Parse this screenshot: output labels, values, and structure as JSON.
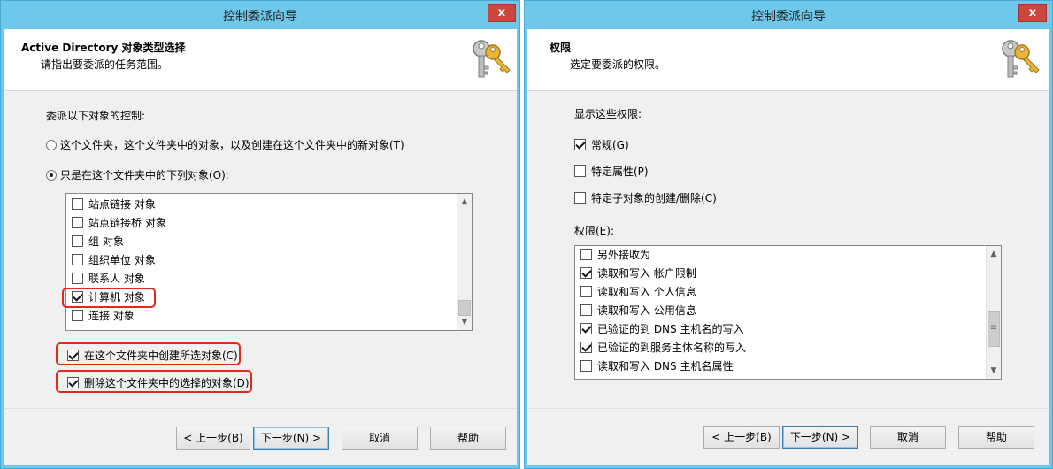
{
  "left": {
    "title": "控制委派向导",
    "close": "x",
    "header": {
      "title": "Active Directory 对象类型选择",
      "subtitle": "请指出要委派的任务范围。"
    },
    "delegate_label": "委派以下对象的控制:",
    "radio1": "这个文件夹，这个文件夹中的对象，以及创建在这个文件夹中的新对象(T)",
    "radio2": "只是在这个文件夹中的下列对象(O):",
    "objects": [
      {
        "label": "站点链接 对象",
        "checked": false
      },
      {
        "label": "站点链接桥 对象",
        "checked": false
      },
      {
        "label": "组 对象",
        "checked": false
      },
      {
        "label": "组织单位 对象",
        "checked": false
      },
      {
        "label": "联系人 对象",
        "checked": false
      },
      {
        "label": "计算机 对象",
        "checked": true
      },
      {
        "label": "连接 对象",
        "checked": false
      }
    ],
    "create_option": "在这个文件夹中创建所选对象(C)",
    "delete_option": "删除这个文件夹中的选择的对象(D)",
    "buttons": {
      "back": "< 上一步(B)",
      "next": "下一步(N) >",
      "cancel": "取消",
      "help": "帮助"
    }
  },
  "right": {
    "title": "控制委派向导",
    "close": "x",
    "header": {
      "title": "权限",
      "subtitle": "选定要委派的权限。"
    },
    "show_label": "显示这些权限:",
    "filters": [
      {
        "label": "常规(G)",
        "checked": true
      },
      {
        "label": "特定属性(P)",
        "checked": false
      },
      {
        "label": "特定子对象的创建/删除(C)",
        "checked": false
      }
    ],
    "perm_label": "权限(E):",
    "permissions": [
      {
        "label": "另外接收为",
        "checked": false
      },
      {
        "label": "读取和写入 帐户限制",
        "checked": true
      },
      {
        "label": "读取和写入 个人信息",
        "checked": false
      },
      {
        "label": "读取和写入 公用信息",
        "checked": false
      },
      {
        "label": "已验证的到 DNS 主机名的写入",
        "checked": true
      },
      {
        "label": "已验证的到服务主体名称的写入",
        "checked": true
      },
      {
        "label": "读取和写入 DNS 主机名属性",
        "checked": false
      }
    ],
    "buttons": {
      "back": "< 上一步(B)",
      "next": "下一步(N) >",
      "cancel": "取消",
      "help": "帮助"
    }
  },
  "icons": {
    "keys": "keys-icon",
    "scroll_up": "▲",
    "scroll_down": "▼",
    "grip": "≡"
  },
  "colors": {
    "titlebar": "#6ec8ea",
    "close": "#c9473d",
    "highlight": "#e22a1c"
  }
}
